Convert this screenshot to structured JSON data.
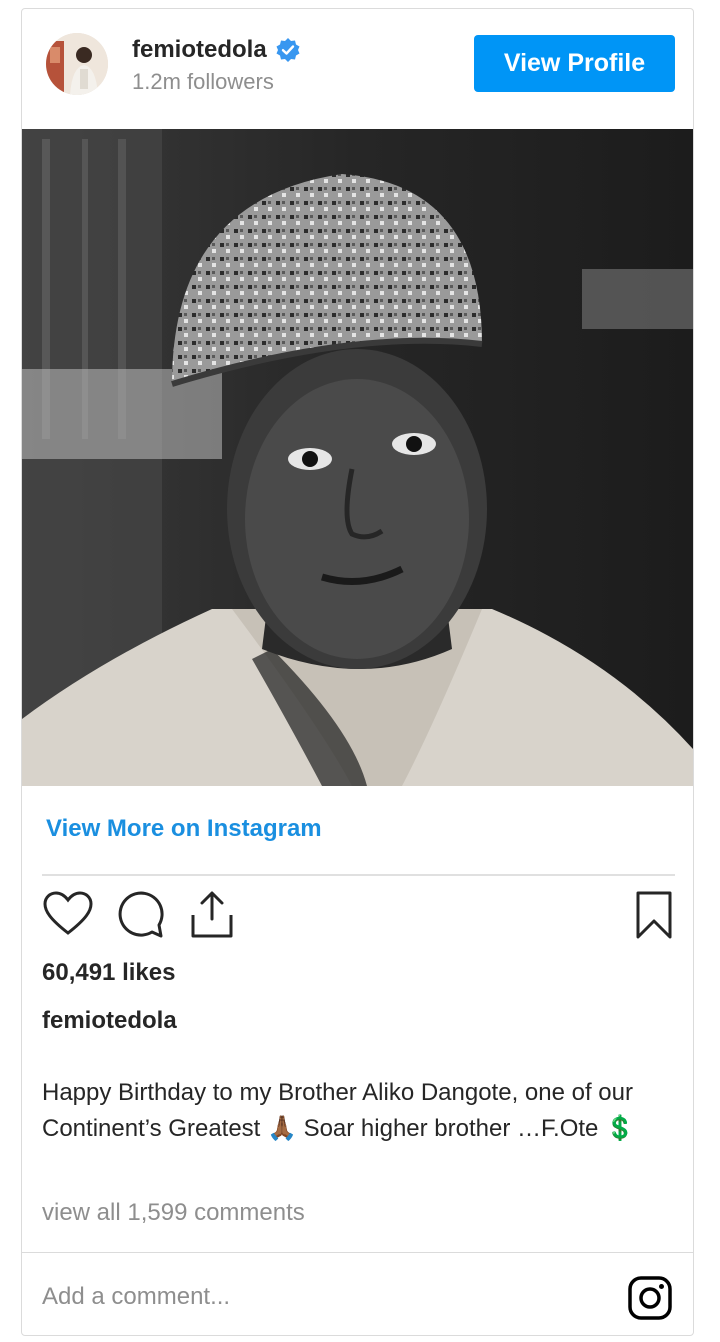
{
  "header": {
    "username": "femiotedola",
    "followers": "1.2m followers",
    "verified_icon": "verified-badge-icon",
    "view_profile_label": "View Profile"
  },
  "post": {
    "view_more_label": "View More on Instagram",
    "likes": "60,491 likes",
    "caption_user": "femiotedola",
    "caption": "Happy Birthday to my Brother Aliko Dangote, one of our Continent’s Greatest 🙏🏾 Soar higher brother …F.Ote 💲",
    "view_comments": "view all 1,599 comments"
  },
  "actions": {
    "like_icon": "heart-icon",
    "comment_icon": "comment-icon",
    "share_icon": "share-icon",
    "save_icon": "bookmark-icon"
  },
  "comment_bar": {
    "placeholder": "Add a comment...",
    "logo_icon": "instagram-icon"
  },
  "colors": {
    "accent": "#0095f6",
    "link": "#1a8fe0",
    "muted": "#8e8e8e",
    "text": "#262626"
  }
}
